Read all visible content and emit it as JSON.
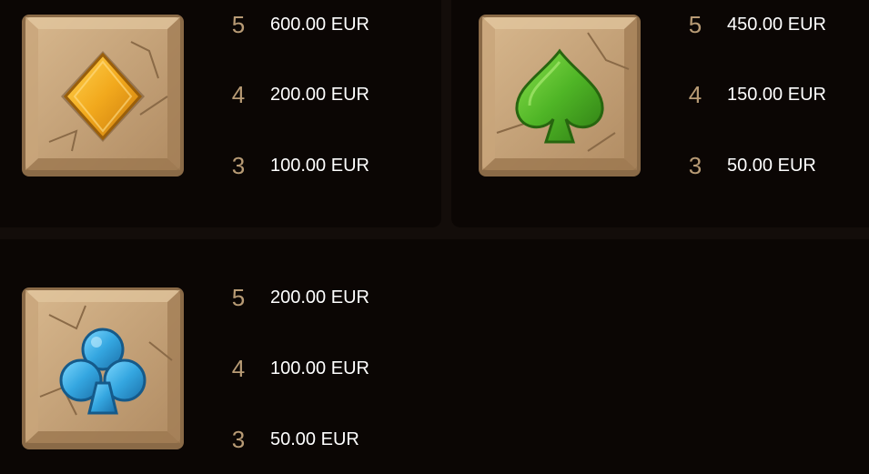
{
  "paytable": {
    "symbols": [
      {
        "icon": "yellow-diamond-icon",
        "color": "#f0a81c",
        "payouts": [
          {
            "count": "5",
            "amount": "600.00 EUR"
          },
          {
            "count": "4",
            "amount": "200.00 EUR"
          },
          {
            "count": "3",
            "amount": "100.00 EUR"
          }
        ]
      },
      {
        "icon": "green-spade-icon",
        "color": "#5cc22e",
        "payouts": [
          {
            "count": "5",
            "amount": "450.00 EUR"
          },
          {
            "count": "4",
            "amount": "150.00 EUR"
          },
          {
            "count": "3",
            "amount": "50.00 EUR"
          }
        ]
      },
      {
        "icon": "blue-club-icon",
        "color": "#3ab0e6",
        "payouts": [
          {
            "count": "5",
            "amount": "200.00 EUR"
          },
          {
            "count": "4",
            "amount": "100.00 EUR"
          },
          {
            "count": "3",
            "amount": "50.00 EUR"
          }
        ]
      }
    ]
  },
  "colors": {
    "background": "#130d0a",
    "panel": "#0b0604",
    "count_text": "#b89b75",
    "amount_text": "#ffffff",
    "stone": "#c9a67c"
  }
}
